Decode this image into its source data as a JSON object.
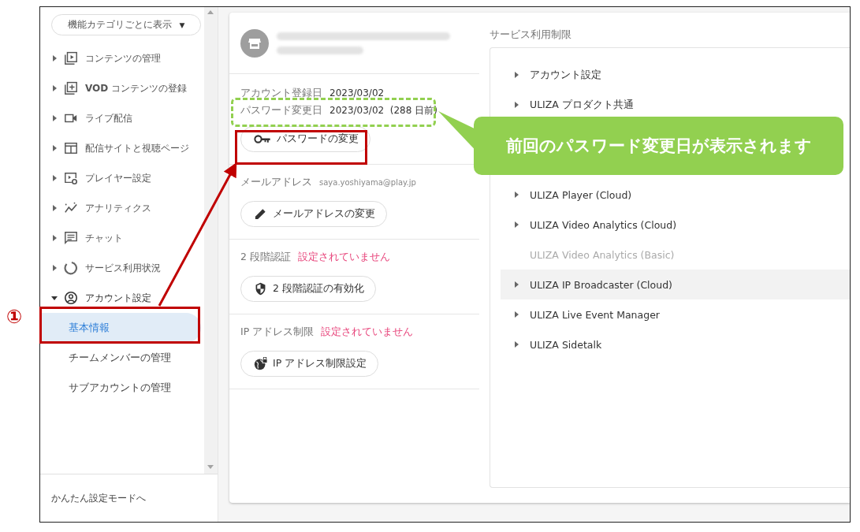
{
  "sidebar": {
    "filter": {
      "label": "機能カテゴリごとに表示",
      "caret": "▼"
    },
    "items": [
      {
        "label": "コンテンツの管理",
        "expanded": false
      },
      {
        "label": "**VOD** コンテンツの登録",
        "expanded": false
      },
      {
        "label": "ライブ配信",
        "expanded": false
      },
      {
        "label": "配信サイトと視聴ページ",
        "expanded": false
      },
      {
        "label": "プレイヤー設定",
        "expanded": false
      },
      {
        "label": "アナリティクス",
        "expanded": false
      },
      {
        "label": "チャット",
        "expanded": false
      },
      {
        "label": "サービス利用状況",
        "expanded": false
      },
      {
        "label": "アカウント設定",
        "expanded": true,
        "children": [
          {
            "label": "基本情報",
            "selected": true
          },
          {
            "label": "チームメンバーの管理",
            "selected": false
          },
          {
            "label": "サブアカウントの管理",
            "selected": false
          }
        ]
      }
    ],
    "footer_link": "かんたん設定モードへ"
  },
  "account": {
    "info_rows": [
      {
        "label": "アカウント登録日",
        "value": "2023/03/02"
      },
      {
        "label": "パスワード変更日",
        "value": "2023/03/02  (288 日前)"
      }
    ],
    "password_button": "パスワードの変更",
    "email": {
      "label": "メールアドレス",
      "value": "saya.yoshiyama@play.jp",
      "button": "メールアドレスの変更"
    },
    "two_factor": {
      "label": "2 段階認証",
      "status": "設定されていません",
      "enabled": false,
      "button": "2 段階認証の有効化"
    },
    "ip_restriction": {
      "label": "IP アドレス制限",
      "status": "設定されていません",
      "enabled": false,
      "button": "IP アドレス制限設定"
    }
  },
  "service_limits": {
    "title": "サービス利用制限",
    "items": [
      {
        "label": "アカウント設定",
        "disabled": false,
        "highlighted": false
      },
      {
        "label": "ULIZA プロダクト共通",
        "disabled": false,
        "highlighted": false
      },
      {
        "label": "ULIZA Player (Cloud)",
        "disabled": false,
        "highlighted": false
      },
      {
        "label": "ULIZA Video Analytics (Cloud)",
        "disabled": false,
        "highlighted": false
      },
      {
        "label": "ULIZA Video Analytics (Basic)",
        "disabled": true,
        "highlighted": false
      },
      {
        "label": "ULIZA IP Broadcaster (Cloud)",
        "disabled": false,
        "highlighted": true
      },
      {
        "label": "ULIZA Live Event Manager",
        "disabled": false,
        "highlighted": false
      },
      {
        "label": "ULIZA Sidetalk",
        "disabled": false,
        "highlighted": false
      }
    ]
  },
  "annotations": {
    "step_marker": "①",
    "callout": "前回のパスワード変更日が表示されます"
  }
}
